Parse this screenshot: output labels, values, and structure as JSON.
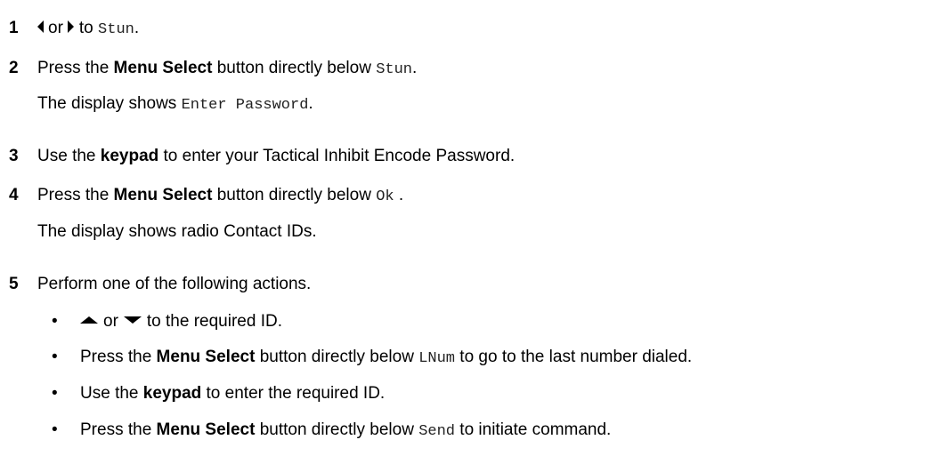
{
  "steps": [
    {
      "num": "1",
      "mid": "or",
      "end": "to",
      "code": "Stun",
      "tail": "."
    },
    {
      "num": "2",
      "pre": "Press the",
      "bold": "Menu Select",
      "post": "button directly below",
      "code": "Stun",
      "tail": "."
    },
    {
      "note_pre": "The display shows",
      "note_code": "Enter Password",
      "note_tail": "."
    },
    {
      "num": "3",
      "pre": "Use the",
      "bold": "keypad",
      "post": "to enter your Tactical Inhibit Encode Password."
    },
    {
      "num": "4",
      "pre": "Press the",
      "bold": "Menu Select",
      "post": "button directly below",
      "code": "Ok",
      "tail": " ."
    },
    {
      "note": "The display shows radio Contact IDs."
    },
    {
      "num": "5",
      "text": "Perform one of the following actions."
    }
  ],
  "bullets": [
    {
      "dot": "•",
      "mid": "or",
      "end": "to the required ID."
    },
    {
      "dot": "•",
      "pre": "Press the",
      "bold": "Menu Select",
      "post": "button directly below",
      "code": "LNum",
      "tail": "to go to the last number dialed."
    },
    {
      "dot": "•",
      "pre": "Use the",
      "bold": "keypad",
      "post": "to enter the required ID."
    },
    {
      "dot": "•",
      "pre": "Press the",
      "bold": "Menu Select",
      "post": "button directly below",
      "code": "Send",
      "tail": "to initiate command."
    }
  ],
  "icons": [
    "left-arrow-icon",
    "right-arrow-icon",
    "up-arrow-icon",
    "down-arrow-icon"
  ]
}
